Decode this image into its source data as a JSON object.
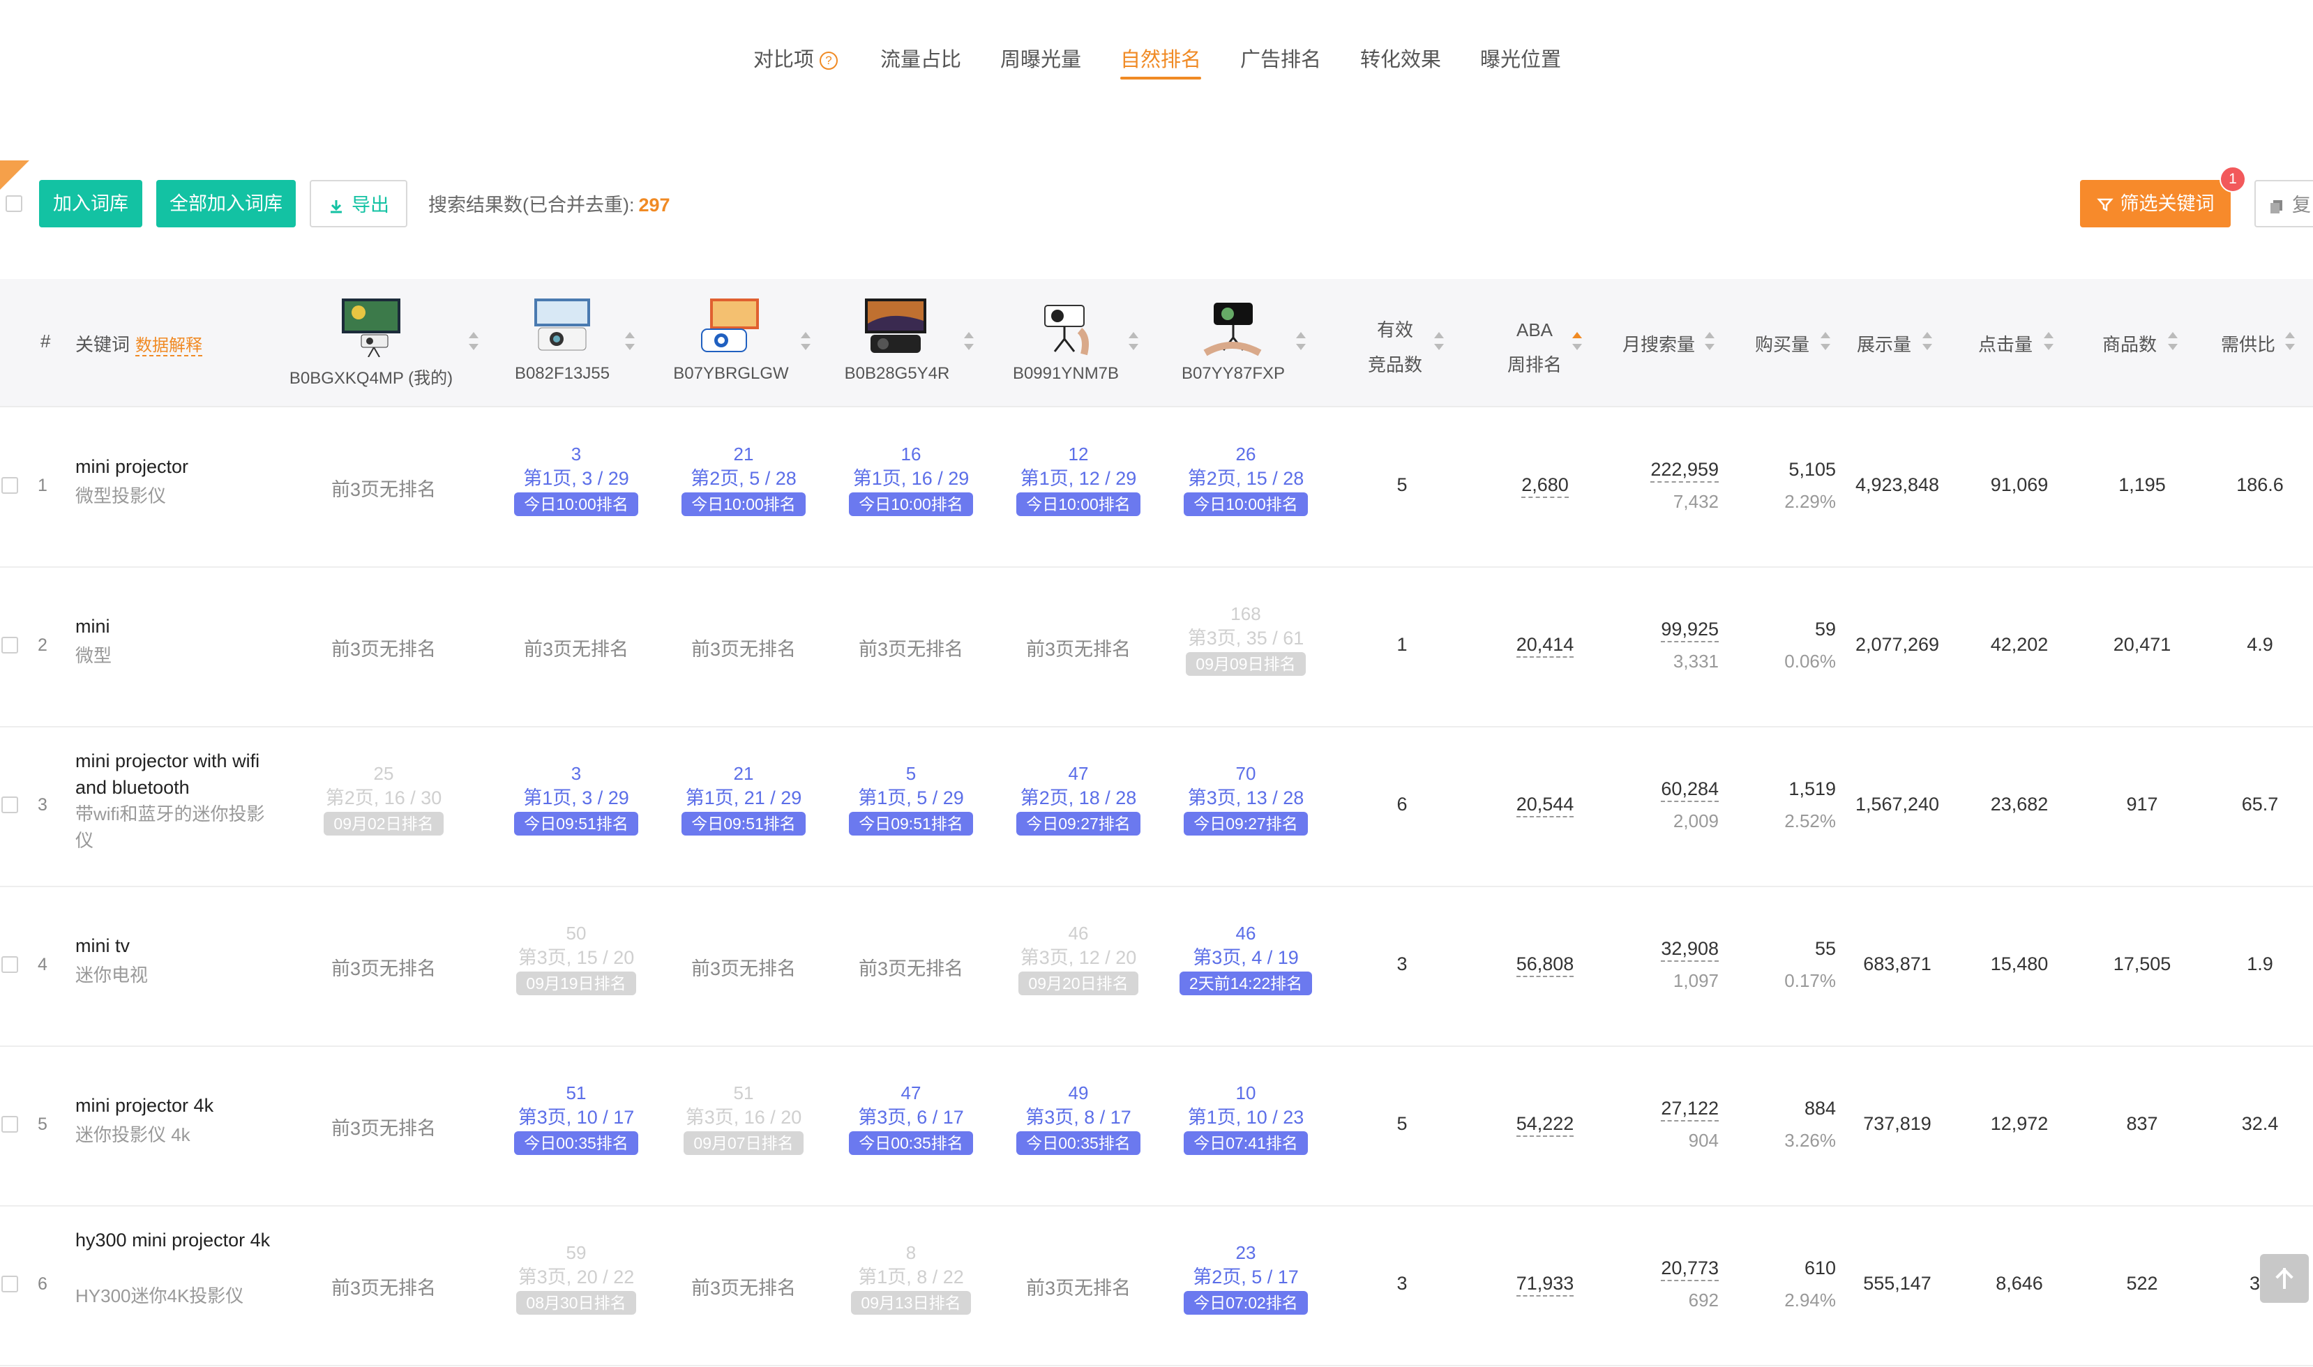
{
  "tabs": [
    {
      "label": "对比项",
      "help": "?"
    },
    {
      "label": "流量占比"
    },
    {
      "label": "周曝光量"
    },
    {
      "label": "自然排名",
      "active": true
    },
    {
      "label": "广告排名"
    },
    {
      "label": "转化效果"
    },
    {
      "label": "曝光位置"
    }
  ],
  "toolbar": {
    "add_to_lib": "加入词库",
    "add_all_to_lib": "全部加入词库",
    "export": "导出",
    "result_label": "搜索结果数(已合并去重):",
    "result_count": "297",
    "filter_keywords": "筛选关键词",
    "filter_badge": "1",
    "copy_partial": "复"
  },
  "header": {
    "index": "#",
    "keyword": "关键词",
    "data_explain": "数据解释",
    "asins": [
      "B0BGXKQ4MP (我的)",
      "B082F13J55",
      "B07YBRGLGW",
      "B0B28G5Y4R",
      "B0991YNM7B",
      "B07YY87FXP"
    ],
    "valid_competitors_1": "有效",
    "valid_competitors_2": "竞品数",
    "aba_1": "ABA",
    "aba_2": "周排名",
    "monthly_search": "月搜索量",
    "purchases": "购买量",
    "impressions": "展示量",
    "clicks": "点击量",
    "products": "商品数",
    "supply_demand": "需供比"
  },
  "rows": [
    {
      "index": "1",
      "kw_en": "mini projector",
      "kw_cn": "微型投影仪",
      "ranks": [
        {
          "state": "none",
          "text": "前3页无排名"
        },
        {
          "state": "active",
          "num": "3",
          "page": "第1页, 3 / 29",
          "tag": "今日10:00排名"
        },
        {
          "state": "active",
          "num": "21",
          "page": "第2页, 5 / 28",
          "tag": "今日10:00排名"
        },
        {
          "state": "active",
          "num": "16",
          "page": "第1页, 16 / 29",
          "tag": "今日10:00排名"
        },
        {
          "state": "active",
          "num": "12",
          "page": "第1页, 12 / 29",
          "tag": "今日10:00排名"
        },
        {
          "state": "active",
          "num": "26",
          "page": "第2页, 15 / 28",
          "tag": "今日10:00排名"
        }
      ],
      "valid": "5",
      "aba": "2,680",
      "monthly": "222,959",
      "monthly_sub": "7,432",
      "purchase": "5,105",
      "purchase_rate": "2.29%",
      "impressions": "4,923,848",
      "clicks": "91,069",
      "products": "1,195",
      "ratio": "186.6"
    },
    {
      "index": "2",
      "kw_en": "mini",
      "kw_cn": "微型",
      "ranks": [
        {
          "state": "none",
          "text": "前3页无排名"
        },
        {
          "state": "none",
          "text": "前3页无排名"
        },
        {
          "state": "none",
          "text": "前3页无排名"
        },
        {
          "state": "none",
          "text": "前3页无排名"
        },
        {
          "state": "none",
          "text": "前3页无排名"
        },
        {
          "state": "stale",
          "num": "168",
          "page": "第3页, 35 / 61",
          "tag": "09月09日排名"
        }
      ],
      "valid": "1",
      "aba": "20,414",
      "monthly": "99,925",
      "monthly_sub": "3,331",
      "purchase": "59",
      "purchase_rate": "0.06%",
      "impressions": "2,077,269",
      "clicks": "42,202",
      "products": "20,471",
      "ratio": "4.9"
    },
    {
      "index": "3",
      "kw_en": "mini projector with wifi and bluetooth",
      "kw_cn": "带wifi和蓝牙的迷你投影仪",
      "ranks": [
        {
          "state": "stale",
          "num": "25",
          "page": "第2页, 16 / 30",
          "tag": "09月02日排名"
        },
        {
          "state": "active",
          "num": "3",
          "page": "第1页, 3 / 29",
          "tag": "今日09:51排名"
        },
        {
          "state": "active",
          "num": "21",
          "page": "第1页, 21 / 29",
          "tag": "今日09:51排名"
        },
        {
          "state": "active",
          "num": "5",
          "page": "第1页, 5 / 29",
          "tag": "今日09:51排名"
        },
        {
          "state": "active",
          "num": "47",
          "page": "第2页, 18 / 28",
          "tag": "今日09:27排名"
        },
        {
          "state": "active",
          "num": "70",
          "page": "第3页, 13 / 28",
          "tag": "今日09:27排名"
        }
      ],
      "valid": "6",
      "aba": "20,544",
      "monthly": "60,284",
      "monthly_sub": "2,009",
      "purchase": "1,519",
      "purchase_rate": "2.52%",
      "impressions": "1,567,240",
      "clicks": "23,682",
      "products": "917",
      "ratio": "65.7"
    },
    {
      "index": "4",
      "kw_en": "mini tv",
      "kw_cn": "迷你电视",
      "ranks": [
        {
          "state": "none",
          "text": "前3页无排名"
        },
        {
          "state": "stale",
          "num": "50",
          "page": "第3页, 15 / 20",
          "tag": "09月19日排名"
        },
        {
          "state": "none",
          "text": "前3页无排名"
        },
        {
          "state": "none",
          "text": "前3页无排名"
        },
        {
          "state": "stale",
          "num": "46",
          "page": "第3页, 12 / 20",
          "tag": "09月20日排名"
        },
        {
          "state": "active",
          "num": "46",
          "page": "第3页, 4 / 19",
          "tag": "2天前14:22排名"
        }
      ],
      "valid": "3",
      "aba": "56,808",
      "monthly": "32,908",
      "monthly_sub": "1,097",
      "purchase": "55",
      "purchase_rate": "0.17%",
      "impressions": "683,871",
      "clicks": "15,480",
      "products": "17,505",
      "ratio": "1.9"
    },
    {
      "index": "5",
      "kw_en": "mini projector 4k",
      "kw_cn": "迷你投影仪 4k",
      "ranks": [
        {
          "state": "none",
          "text": "前3页无排名"
        },
        {
          "state": "active",
          "num": "51",
          "page": "第3页, 10 / 17",
          "tag": "今日00:35排名"
        },
        {
          "state": "stale",
          "num": "51",
          "page": "第3页, 16 / 20",
          "tag": "09月07日排名"
        },
        {
          "state": "active",
          "num": "47",
          "page": "第3页, 6 / 17",
          "tag": "今日00:35排名"
        },
        {
          "state": "active",
          "num": "49",
          "page": "第3页, 8 / 17",
          "tag": "今日00:35排名"
        },
        {
          "state": "active",
          "num": "10",
          "page": "第1页, 10 / 23",
          "tag": "今日07:41排名"
        }
      ],
      "valid": "5",
      "aba": "54,222",
      "monthly": "27,122",
      "monthly_sub": "904",
      "purchase": "884",
      "purchase_rate": "3.26%",
      "impressions": "737,819",
      "clicks": "12,972",
      "products": "837",
      "ratio": "32.4"
    },
    {
      "index": "6",
      "kw_en": "hy300 mini projector 4k",
      "kw_cn": "HY300迷你4K投影仪",
      "ranks": [
        {
          "state": "none",
          "text": "前3页无排名"
        },
        {
          "state": "stale",
          "num": "59",
          "page": "第3页, 20 / 22",
          "tag": "08月30日排名"
        },
        {
          "state": "none",
          "text": "前3页无排名"
        },
        {
          "state": "stale",
          "num": "8",
          "page": "第1页, 8 / 22",
          "tag": "09月13日排名"
        },
        {
          "state": "none",
          "text": "前3页无排名"
        },
        {
          "state": "active",
          "num": "23",
          "page": "第2页, 5 / 17",
          "tag": "今日07:02排名"
        }
      ],
      "valid": "3",
      "aba": "71,933",
      "monthly": "20,773",
      "monthly_sub": "692",
      "purchase": "610",
      "purchase_rate": "2.94%",
      "impressions": "555,147",
      "clicks": "8,646",
      "products": "522",
      "ratio": "39"
    }
  ],
  "colors": {
    "accent_orange": "#f08a24",
    "green": "#13c2a3",
    "rank_active": "#6b79ef",
    "rank_stale": "#d6d6d6"
  },
  "icons": [
    "help-icon",
    "download-icon",
    "filter-icon",
    "copy-icon",
    "sort-icon",
    "scroll-top-icon"
  ]
}
